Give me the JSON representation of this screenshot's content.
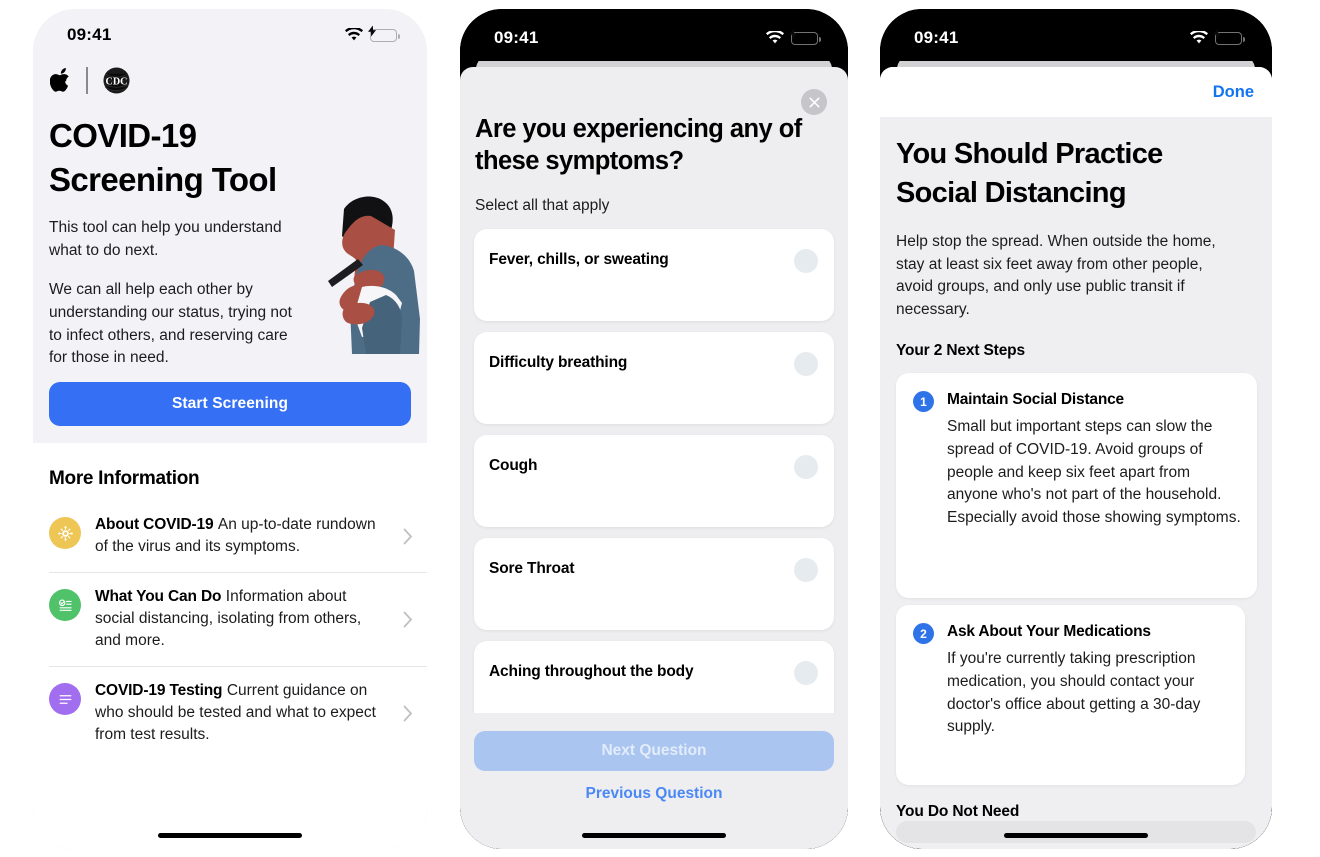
{
  "meta": {
    "accent_blue": "#356ff4",
    "link_blue": "#4a88f5",
    "done_blue": "#1274f0",
    "sheet_bg": "#eeeef0",
    "disabled_blue": "#a9c5f0"
  },
  "status_bar": {
    "time": "09:41",
    "wifi_icon": "wifi-icon",
    "battery_icon": "battery-charging-icon"
  },
  "phone1": {
    "logos": {
      "apple": "apple-logo-icon",
      "divider": "logo-divider",
      "cdc": "cdc-logo-icon"
    },
    "title": "COVID-19 Screening Tool",
    "paragraph1": "This tool can help you understand what to do next.",
    "paragraph2": "We can all help each other by understanding our status, trying not to infect others, and reserving care for those in need.",
    "illustration": "person-using-phone-illustration",
    "cta_label": "Start Screening",
    "section_title": "More Information",
    "info_rows": [
      {
        "icon": "virus-icon",
        "icon_color": "#eec656",
        "title": "About COVID-19",
        "desc": "An up-to-date rundown of the virus and its symptoms.",
        "chevron": "chevron-right-icon"
      },
      {
        "icon": "checklist-icon",
        "icon_color": "#4fc26a",
        "title": "What You Can Do",
        "desc": "Information about social distancing, isolating from others, and more.",
        "chevron": "chevron-right-icon"
      },
      {
        "icon": "document-lines-icon",
        "icon_color": "#a濃"
      }
    ]
  },
  "phone2": {
    "close_icon": "close-icon",
    "question": "Are you experiencing any of these symptoms?",
    "subtitle": "Select all that apply",
    "symptoms": [
      {
        "label": "Fever, chills, or sweating",
        "selected": false
      },
      {
        "label": "Difficulty breathing",
        "selected": false
      },
      {
        "label": "Cough",
        "selected": false
      },
      {
        "label": "Sore Throat",
        "selected": false
      },
      {
        "label": "Aching throughout the body",
        "selected": false
      }
    ],
    "next_label": "Next Question",
    "next_disabled": true,
    "prev_label": "Previous Question"
  },
  "phone3": {
    "done_label": "Done",
    "title": "You Should Practice Social Distancing",
    "paragraph": "Help stop the spread. When outside the home, stay at least six feet away from other people, avoid groups, and only use public transit if necessary.",
    "steps_heading": "Your 2 Next Steps",
    "steps": [
      {
        "number": "1",
        "title": "Maintain Social Distance",
        "desc": "Small but important steps can slow the spread of COVID-19. Avoid groups of people and keep six feet apart from anyone who's not part of the household. Especially avoid those showing symptoms."
      },
      {
        "number": "2",
        "title": "Ask About Your Medications",
        "desc": "If you're currently taking prescription medication, you should contact your doctor's office about getting a 30-day supply."
      }
    ],
    "next_section": "You Do Not Need"
  }
}
